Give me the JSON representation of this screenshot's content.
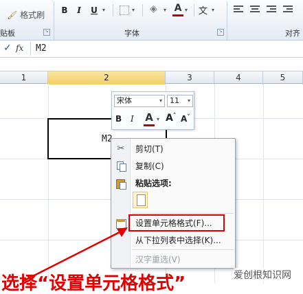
{
  "ribbon": {
    "format_painter": "格式刷",
    "clipboard_label": "贴板",
    "font_label": "字体",
    "align_label": "对齐",
    "bold": "B",
    "italic": "I",
    "underline": "U",
    "font_color_letter": "A",
    "wen_letter": "文",
    "font_color": "#c00000"
  },
  "formula_bar": {
    "check": "✓",
    "fx": "fx",
    "content": "M2"
  },
  "columns": [
    "1",
    "2",
    "3",
    "4",
    "5"
  ],
  "selected_column": "2",
  "cell_text": "M2",
  "mini_toolbar": {
    "font_name": "宋体",
    "font_size": "11",
    "bold": "B",
    "italic": "I",
    "color_letter": "A",
    "grow": "A",
    "shrink": "A",
    "grow_mark": "˄",
    "shrink_mark": "˅"
  },
  "context_menu": {
    "cut": "剪切(T)",
    "copy": "复制(C)",
    "paste_options": "粘贴选项:",
    "format_cells": "设置单元格格式(F)...",
    "pick_from_list": "从下拉列表中选择(K)...",
    "hanzi_reselect": "汉字重选(V)"
  },
  "overlay": {
    "caption_partial": "选择“设置单元格格式”",
    "watermark": "爱创根知识网",
    "highlight_color": "#e00000"
  }
}
